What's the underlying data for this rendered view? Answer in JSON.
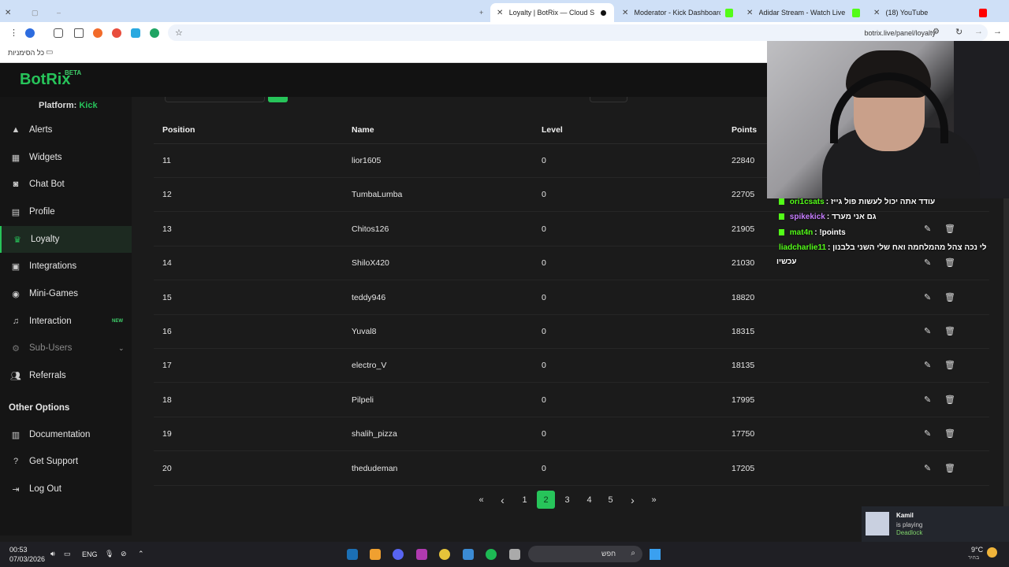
{
  "browser": {
    "tabs": [
      {
        "label": "Loyalty | BotRix — Cloud Stream",
        "active": true
      },
      {
        "label": "Moderator - Kick Dashboard"
      },
      {
        "label": "Adidar Stream - Watch Live on"
      },
      {
        "label": "(18) YouTube"
      }
    ],
    "new_tab_label": "+",
    "url": "botrix.live/panel/loyalty",
    "bookmarks_folder": "כל הסימניות"
  },
  "app": {
    "logo": "BotRix",
    "beta": "BETA",
    "platform_label": "Platform:",
    "platform_value": "Kick"
  },
  "sidebar": {
    "items": [
      {
        "label": "Alerts",
        "icon": "warning-icon"
      },
      {
        "label": "Widgets",
        "icon": "grid-icon"
      },
      {
        "label": "Chat Bot",
        "icon": "robot-icon"
      },
      {
        "label": "Profile",
        "icon": "id-card-icon"
      },
      {
        "label": "Loyalty",
        "icon": "trophy-icon",
        "active": true
      },
      {
        "label": "Integrations",
        "icon": "plug-icon"
      },
      {
        "label": "Mini-Games",
        "icon": "gamepad-icon"
      },
      {
        "label": "Interaction",
        "icon": "music-icon",
        "badge": "NEW"
      },
      {
        "label": "Sub-Users",
        "icon": "gear-icon",
        "dim": true
      },
      {
        "label": "Referrals",
        "icon": "users-icon"
      }
    ],
    "section_title": "Other Options",
    "other": [
      {
        "label": "Documentation",
        "icon": "book-icon"
      },
      {
        "label": "Get Support",
        "icon": "question-icon"
      },
      {
        "label": "Log Out",
        "icon": "logout-icon"
      }
    ]
  },
  "table": {
    "headers": [
      "Position",
      "Name",
      "Level",
      "Points"
    ],
    "rows": [
      {
        "position": "11",
        "name": "lior1605",
        "level": "0",
        "points": "22840"
      },
      {
        "position": "12",
        "name": "TumbaLumba",
        "level": "0",
        "points": "22705"
      },
      {
        "position": "13",
        "name": "Chitos126",
        "level": "0",
        "points": "21905"
      },
      {
        "position": "14",
        "name": "ShiloX420",
        "level": "0",
        "points": "21030"
      },
      {
        "position": "15",
        "name": "teddy946",
        "level": "0",
        "points": "18820"
      },
      {
        "position": "16",
        "name": "Yuval8",
        "level": "0",
        "points": "18315"
      },
      {
        "position": "17",
        "name": "electro_V",
        "level": "0",
        "points": "18135"
      },
      {
        "position": "18",
        "name": "Pilpeli",
        "level": "0",
        "points": "17995"
      },
      {
        "position": "19",
        "name": "shalih_pizza",
        "level": "0",
        "points": "17750"
      },
      {
        "position": "20",
        "name": "thedudeman",
        "level": "0",
        "points": "17205"
      }
    ]
  },
  "pagination": {
    "first": "«",
    "prev": "‹",
    "pages": [
      "1",
      "2",
      "3",
      "4",
      "5"
    ],
    "current": "2",
    "next": "›",
    "last": "»"
  },
  "overlay_chat": [
    {
      "user": "ori1csats",
      "user_color": "#53fc18",
      "text": "עודד אתה יכול לעשות פול גייז"
    },
    {
      "user": "spikekick",
      "user_color": "#c77dff",
      "text": "גם אני מערד"
    },
    {
      "user": "mat4n",
      "user_color": "#53fc18",
      "text": "!points"
    },
    {
      "user": "liadcharlie11",
      "user_color": "#53fc18",
      "text": "לי נכה צהל מהמלחמה ואח שלי השני בלבנון"
    },
    {
      "user": "",
      "user_color": "#ffffff",
      "text": "עכשיו"
    }
  ],
  "notification": {
    "name": "Kamil",
    "status": "is playing",
    "game": "Deadlock"
  },
  "taskbar": {
    "time": "00:53",
    "date": "07/03/2026",
    "lang": "ENG",
    "search_placeholder": "חפש",
    "weather_temp": "9°C",
    "weather_label": "בהיר"
  },
  "colors": {
    "accent": "#27c45a",
    "kick_green": "#53fc18",
    "bg": "#1b1b1b"
  }
}
